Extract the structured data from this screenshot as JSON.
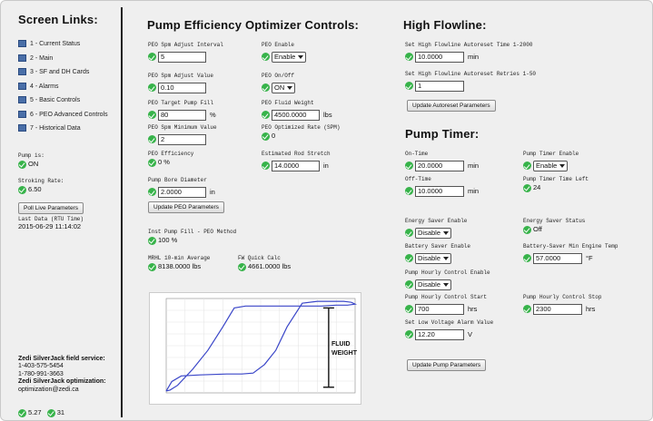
{
  "left": {
    "title": "Screen Links:",
    "links": [
      "1 - Current Status",
      "2 - Main",
      "3 - SF and DH Cards",
      "4 - Alarms",
      "5 - Basic Controls",
      "6 - PEO Advanced Controls",
      "7 - Historical Data"
    ],
    "pump_is_label": "Pump is:",
    "pump_is_value": "ON",
    "stroking_label": "Stroking Rate:",
    "stroking_value": "6.50",
    "poll_button": "Poll Live Parameters",
    "last_data_label": "Last Data (RTU Time)",
    "last_data_value": "2015-06-29 11:14:02",
    "service_title": "Zedi SilverJack field service:",
    "phone1": "1-403-575-5454",
    "phone2": "1-780-991-3663",
    "opt_title": "Zedi SilverJack optimization:",
    "opt_email": "optimization@zedi.ca",
    "footer_a": "5.27",
    "footer_b": "31"
  },
  "peo": {
    "title": "Pump Efficiency Optimizer Controls:",
    "spm_adjust_interval_label": "PEO Spm Adjust Interval",
    "spm_adjust_interval_value": "5",
    "enable_label": "PEO Enable",
    "enable_value": "Enable",
    "spm_adjust_value_label": "PEO Spm Adjust Value",
    "spm_adjust_value_value": "0.10",
    "onoff_label": "PEO On/Off",
    "onoff_value": "ON",
    "target_fill_label": "PEO Target Pump Fill",
    "target_fill_value": "80",
    "target_fill_unit": "%",
    "fluid_weight_label": "PEO Fluid Weight",
    "fluid_weight_value": "4500.0000",
    "fluid_weight_unit": "lbs",
    "spm_min_label": "PEO Spm Minimum Value",
    "spm_min_value": "2",
    "opt_rate_label": "PEO Optimized Rate (SPM)",
    "opt_rate_value": "0",
    "efficiency_label": "PEO Efficiency",
    "efficiency_value": "0 %",
    "rod_stretch_label": "Estimated Rod Stretch",
    "rod_stretch_value": "14.0000",
    "rod_stretch_unit": "in",
    "bore_label": "Pump Bore Diameter",
    "bore_value": "2.0000",
    "bore_unit": "in",
    "update_button": "Update PEO Parameters",
    "inst_fill_label": "Inst Pump Fill - PEO Method",
    "inst_fill_value": "100 %",
    "mrhl_label": "MRHL 10-min Average",
    "mrhl_value": "8138.0000 lbs",
    "fw_label": "FW Quick Calc",
    "fw_value": "4661.0000 lbs",
    "chart_annotation_1": "FLUID",
    "chart_annotation_2": "WEIGHT"
  },
  "flowline": {
    "title": "High Flowline:",
    "retry_time_label": "Set High Flowline Autoreset Time 1-2000",
    "retry_time_value": "10.0000",
    "retry_time_unit": "min",
    "retries_label": "Set High Flowline Autoreset Retries 1-50",
    "retries_value": "1",
    "update_button": "Update Autoreset Parameters"
  },
  "timer": {
    "title": "Pump Timer:",
    "on_time_label": "On-Time",
    "on_time_value": "20.0000",
    "on_time_unit": "min",
    "timer_enable_label": "Pump Timer Enable",
    "timer_enable_value": "Enable",
    "off_time_label": "Off-Time",
    "off_time_value": "10.0000",
    "off_time_unit": "min",
    "time_left_label": "Pump Timer Time Left",
    "time_left_value": "24",
    "es_enable_label": "Energy Saver Enable",
    "es_enable_value": "Disable",
    "es_status_label": "Energy Saver Status",
    "es_status_value": "Off",
    "bs_enable_label": "Battery Saver Enable",
    "bs_enable_value": "Disable",
    "bs_temp_label": "Battery-Saver Min Engine Temp",
    "bs_temp_value": "57.0000",
    "bs_temp_unit": "°F",
    "hourly_enable_label": "Pump Hourly Control Enable",
    "hourly_enable_value": "Disable",
    "hourly_start_label": "Pump Hourly Control Start",
    "hourly_start_value": "700",
    "hourly_start_unit": "hrs",
    "hourly_stop_label": "Pump Hourly Control Stop",
    "hourly_stop_value": "2300",
    "hourly_stop_unit": "hrs",
    "low_voltage_label": "Set Low Voltage Alarm Value",
    "low_voltage_value": "12.20",
    "low_voltage_unit": "V",
    "update_button": "Update Pump Parameters"
  },
  "chart_data": {
    "type": "line",
    "x": [
      0,
      3,
      8,
      18,
      32,
      40,
      46,
      52,
      58,
      64,
      72,
      80,
      88,
      94,
      98,
      100,
      96,
      90,
      82,
      74,
      66,
      58,
      50,
      42,
      36,
      30,
      22,
      14,
      6,
      2,
      0
    ],
    "y": [
      2,
      12,
      18,
      19,
      20,
      20,
      21,
      30,
      45,
      70,
      95,
      97,
      97,
      97,
      96,
      94,
      93,
      93,
      92,
      92,
      92,
      92,
      92,
      92,
      90,
      70,
      45,
      25,
      8,
      3,
      2
    ],
    "ylim": [
      0,
      100
    ],
    "xlim": [
      0,
      100
    ],
    "grid": true,
    "color": "#3a46c8"
  }
}
